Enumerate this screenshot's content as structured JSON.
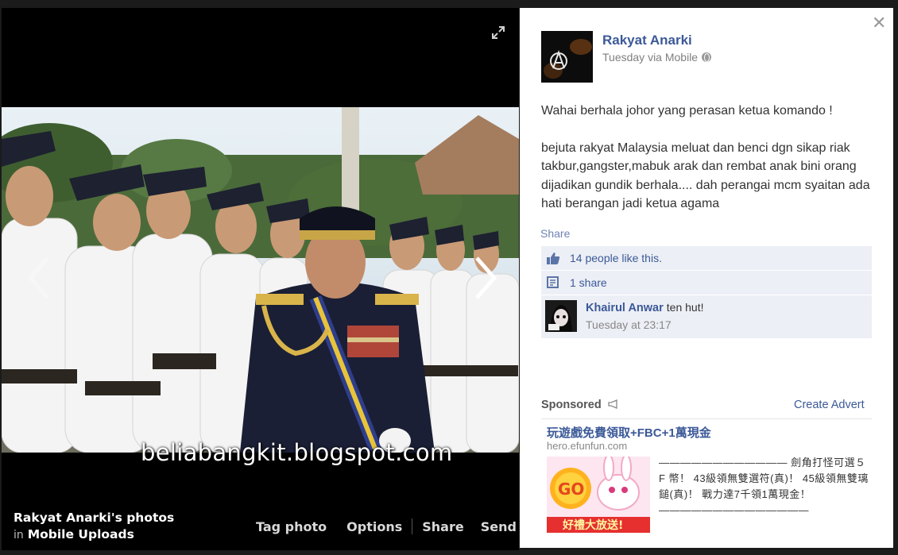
{
  "viewer": {
    "watermark": "beliabangkit.blogspot.com",
    "album_title": "Rakyat Anarki's photos",
    "album_in": "in",
    "album_name": "Mobile Uploads",
    "actions": {
      "tag_photo": "Tag photo",
      "options": "Options",
      "share": "Share",
      "send": "Send"
    }
  },
  "post": {
    "page_name": "Rakyat Anarki",
    "time": "Tuesday via Mobile",
    "paragraph_1": "Wahai berhala johor yang perasan ketua komando !",
    "paragraph_2": "bejuta rakyat Malaysia meluat dan benci dgn sikap riak takbur,gangster,mabuk arak dan rembat anak bini orang dijadikan gundik berhala.... dah perangai mcm syaitan ada hati berangan jadi ketua agama",
    "share_link": "Share",
    "likes_text": "14 people like this.",
    "shares_text": "1 share"
  },
  "comment": {
    "author": "Khairul Anwar",
    "text": "ten hut!",
    "time": "Tuesday at 23:17"
  },
  "sponsored": {
    "label": "Sponsored",
    "create_advert": "Create Advert",
    "ad_title": "玩遊戲免費領取+FBC+1萬現金",
    "ad_url": "hero.efunfun.com",
    "ad_body": "———————————— 劍角打怪可選５F 幣！ 43級領無雙選符(真)！ 45級領無雙璃鎚(真)！ 戰力達7千領1萬現金！ ——————————————",
    "ad_image_go": "GO",
    "ad_image_banner": "好禮大放送!"
  },
  "colors": {
    "link_blue": "#3b5998",
    "panel_row_bg": "#eceff5",
    "viewer_bg": "#000000"
  },
  "icons": {
    "expand": "expand-icon",
    "close": "close-icon",
    "prev": "chevron-left-icon",
    "next": "chevron-right-icon",
    "like": "thumbs-up-icon",
    "share": "share-icon",
    "globe": "globe-icon",
    "sponsored": "megaphone-icon"
  }
}
